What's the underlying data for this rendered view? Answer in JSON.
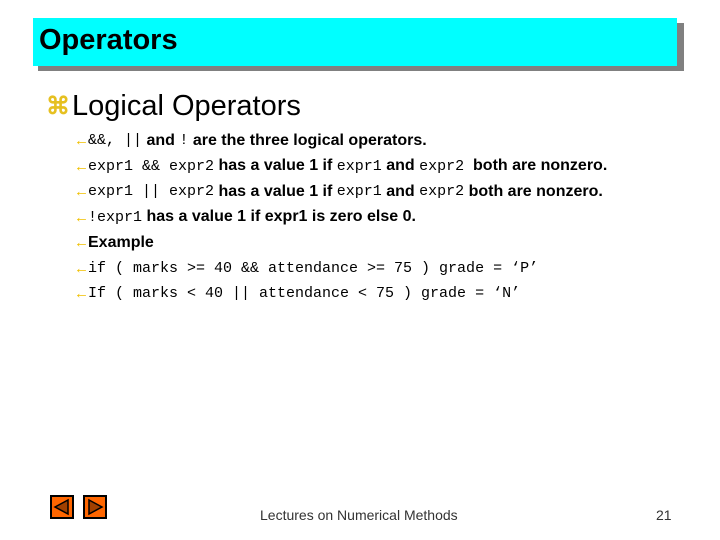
{
  "slide": {
    "title": "Operators",
    "heading": "Logical Operators",
    "heading_bullet": "⌘",
    "items": [
      {
        "segments": [
          {
            "t": "&&, ||",
            "mono": true
          },
          {
            "t": " and ",
            "mono": false
          },
          {
            "t": "!",
            "mono": true
          },
          {
            "t": " are the three logical operators.",
            "mono": false
          }
        ]
      },
      {
        "segments": [
          {
            "t": "expr1 && expr2",
            "mono": true
          },
          {
            "t": " has a value 1 if ",
            "mono": false
          },
          {
            "t": "expr1",
            "mono": true
          },
          {
            "t": " and ",
            "mono": false
          },
          {
            "t": "expr2",
            "mono": true
          },
          {
            "t": "  both are nonzero.",
            "mono": false
          }
        ]
      },
      {
        "segments": [
          {
            "t": "expr1 || expr2",
            "mono": true
          },
          {
            "t": " has a value 1 if ",
            "mono": false
          },
          {
            "t": "expr1",
            "mono": true
          },
          {
            "t": " and ",
            "mono": false
          },
          {
            "t": "expr2",
            "mono": true
          },
          {
            "t": " both are nonzero.",
            "mono": false
          }
        ]
      },
      {
        "segments": [
          {
            "t": "!expr1",
            "mono": true
          },
          {
            "t": " has a value 1 if expr1 is zero else 0.",
            "mono": false
          }
        ]
      },
      {
        "segments": [
          {
            "t": "Example",
            "mono": false
          }
        ]
      },
      {
        "segments": [
          {
            "t": "if ( marks >= 40 && attendance >= 75 ) grade = ‘P’",
            "mono": true
          }
        ]
      },
      {
        "segments": [
          {
            "t": "If ( marks < 40 || attendance < 75 ) grade = ‘N’",
            "mono": true
          }
        ]
      }
    ],
    "item_bullet": "←"
  },
  "footer": {
    "course": "Lectures on Numerical Methods",
    "page_number": "21"
  },
  "nav": {
    "prev_icon": "prev-triangle-icon",
    "next_icon": "next-triangle-icon"
  },
  "colors": {
    "title_bg": "#00ffff",
    "title_shadow": "#808080",
    "bullet": "#f0c000",
    "nav_button": "#ff6600"
  }
}
